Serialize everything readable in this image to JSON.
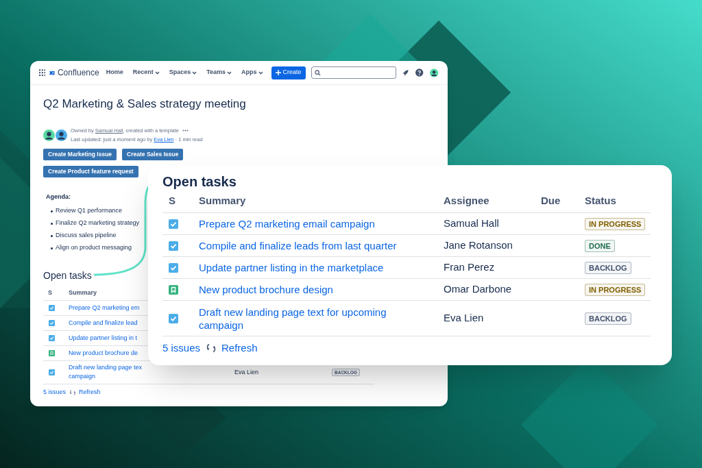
{
  "navbar": {
    "product": "Confluence",
    "links": [
      {
        "label": "Home",
        "dropdown": false
      },
      {
        "label": "Recent",
        "dropdown": true
      },
      {
        "label": "Spaces",
        "dropdown": true
      },
      {
        "label": "Teams",
        "dropdown": true
      },
      {
        "label": "Apps",
        "dropdown": true
      }
    ],
    "create_button": "Create"
  },
  "page": {
    "title": "Q2 Marketing & Sales strategy meeting",
    "owner_prefix": "Owned by",
    "owner": "Samual Hall",
    "owner_suffix": ", created with a template",
    "updated_prefix": "Last updated: just a moment ago by",
    "updated_by": "Eva Lien",
    "read_time": "· 1 min read",
    "buttons": [
      "Create Marketing Issue",
      "Create Sales Issue",
      "Create Product feature request"
    ],
    "agenda": {
      "heading": "Agenda:",
      "items": [
        "Review Q1 performance",
        "Finalize Q2 marketing strategy",
        "Discuss sales pipeline",
        "Align on product messaging"
      ]
    },
    "tasks": {
      "heading": "Open tasks",
      "columns": [
        "S",
        "Summary"
      ],
      "rows": [
        {
          "kind": "task",
          "summary": "Prepare Q2 marketing em"
        },
        {
          "kind": "task",
          "summary": "Compile and finalize lead"
        },
        {
          "kind": "task",
          "summary": "Update partner listing in t"
        },
        {
          "kind": "story",
          "summary": "New product brochure de"
        },
        {
          "kind": "task",
          "summary": "Draft new landing page tex\ncampaign",
          "assignee": "Eva Lien",
          "status": "BACKLOG",
          "color": "#44546f"
        }
      ],
      "count": "5 issues",
      "refresh": "Refresh"
    }
  },
  "zoomed_tasks": {
    "heading": "Open tasks",
    "columns": [
      "S",
      "Summary",
      "Assignee",
      "Due",
      "Status"
    ],
    "rows": [
      {
        "kind": "task",
        "summary": "Prepare Q2 marketing email campaign",
        "assignee": "Samual Hall",
        "status": "IN PROGRESS",
        "color": "#7f5f01"
      },
      {
        "kind": "task",
        "summary": "Compile and finalize leads from last quarter",
        "assignee": "Jane Rotanson",
        "status": "DONE",
        "color": "#216e4e"
      },
      {
        "kind": "task",
        "summary": "Update partner listing in the marketplace",
        "assignee": "Fran Perez",
        "status": "BACKLOG",
        "color": "#44546f"
      },
      {
        "kind": "story",
        "summary": "New product brochure design",
        "assignee": "Omar Darbone",
        "status": "IN PROGRESS",
        "color": "#7f5f01"
      },
      {
        "kind": "task",
        "summary": "Draft new landing page text for upcoming campaign",
        "assignee": "Eva Lien",
        "status": "BACKLOG",
        "color": "#44546f"
      }
    ],
    "count": "5 issues",
    "refresh": "Refresh"
  }
}
